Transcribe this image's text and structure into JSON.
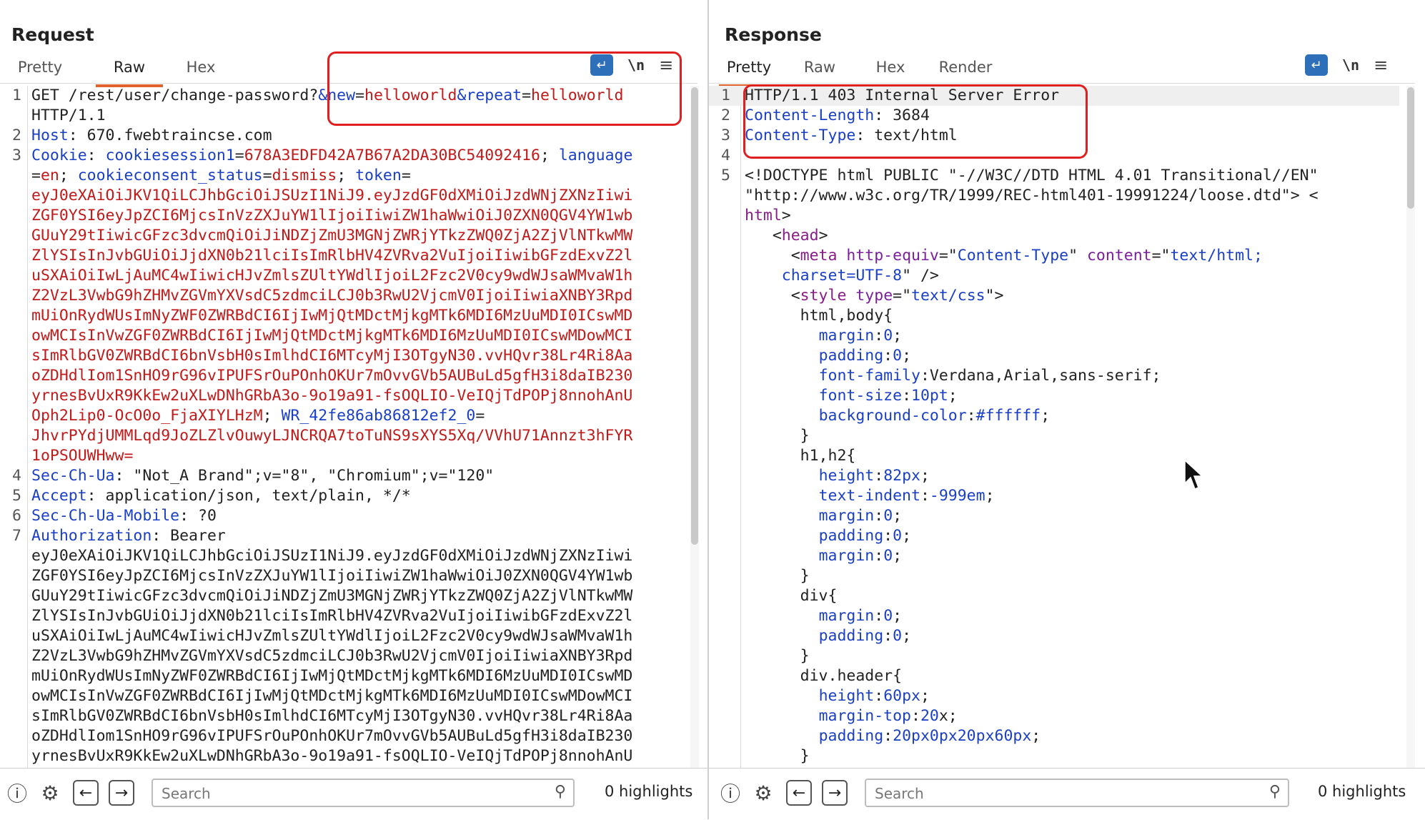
{
  "layout_switch": {
    "options": [
      "split-horizontal",
      "split-vertical",
      "single"
    ],
    "active": "split-horizontal"
  },
  "request": {
    "title": "Request",
    "tabs": [
      "Pretty",
      "Raw",
      "Hex"
    ],
    "active_tab": "Raw",
    "lines": [
      {
        "n": "1",
        "segs": [
          [
            "d",
            "GET /rest/user/change-password?"
          ],
          [
            "b",
            "&new"
          ],
          [
            "d",
            "="
          ],
          [
            "r",
            "helloworld"
          ],
          [
            "b",
            "&repeat"
          ],
          [
            "d",
            "="
          ],
          [
            "r",
            "helloworld"
          ]
        ]
      },
      {
        "n": "",
        "segs": [
          [
            "d",
            "HTTP/1.1"
          ]
        ]
      },
      {
        "n": "2",
        "segs": [
          [
            "b",
            "Host"
          ],
          [
            "d",
            ": 670.fwebtraincse.com"
          ]
        ]
      },
      {
        "n": "3",
        "segs": [
          [
            "b",
            "Cookie"
          ],
          [
            "d",
            ": "
          ],
          [
            "b",
            "cookiesession1"
          ],
          [
            "d",
            "="
          ],
          [
            "r",
            "678A3EDFD42A7B67A2DA30BC54092416"
          ],
          [
            "d",
            "; "
          ],
          [
            "b",
            "language"
          ]
        ]
      },
      {
        "n": "",
        "segs": [
          [
            "d",
            "="
          ],
          [
            "r",
            "en"
          ],
          [
            "d",
            "; "
          ],
          [
            "b",
            "cookieconsent_status"
          ],
          [
            "d",
            "="
          ],
          [
            "r",
            "dismiss"
          ],
          [
            "d",
            "; "
          ],
          [
            "b",
            "token"
          ],
          [
            "d",
            "="
          ]
        ]
      },
      {
        "n": "",
        "segs": [
          [
            "r",
            "eyJ0eXAiOiJKV1QiLCJhbGciOiJSUzI1NiJ9.eyJzdGF0dXMiOiJzdWNjZXNzIiwi"
          ]
        ]
      },
      {
        "n": "",
        "segs": [
          [
            "r",
            "ZGF0YSI6eyJpZCI6MjcsInVzZXJuYW1lIjoiIiwiZW1haWwiOiJ0ZXN0QGV4YW1wb"
          ]
        ]
      },
      {
        "n": "",
        "segs": [
          [
            "r",
            "GUuY29tIiwicGFzc3dvcmQiOiJiNDZjZmU3MGNjZWRjYTkzZWQ0ZjA2ZjVlNTkwMW"
          ]
        ]
      },
      {
        "n": "",
        "segs": [
          [
            "r",
            "ZlYSIsInJvbGUiOiJjdXN0b21lciIsImRlbHV4ZVRva2VuIjoiIiwibGFzdExvZ2l"
          ]
        ]
      },
      {
        "n": "",
        "segs": [
          [
            "r",
            "uSXAiOiIwLjAuMC4wIiwicHJvZmlsZUltYWdlIjoiL2Fzc2V0cy9wdWJsaWMvaW1h"
          ]
        ]
      },
      {
        "n": "",
        "segs": [
          [
            "r",
            "Z2VzL3VwbG9hZHMvZGVmYXVsdC5zdmciLCJ0b3RwU2VjcmV0IjoiIiwiaXNBY3Rpd"
          ]
        ]
      },
      {
        "n": "",
        "segs": [
          [
            "r",
            "mUiOnRydWUsImNyZWF0ZWRBdCI6IjIwMjQtMDctMjkgMTk6MDI6MzUuMDI0ICswMD"
          ]
        ]
      },
      {
        "n": "",
        "segs": [
          [
            "r",
            "owMCIsInVwZGF0ZWRBdCI6IjIwMjQtMDctMjkgMTk6MDI6MzUuMDI0ICswMDowMCI"
          ]
        ]
      },
      {
        "n": "",
        "segs": [
          [
            "r",
            "sImRlbGV0ZWRBdCI6bnVsbH0sImlhdCI6MTcyMjI3OTgyN30.vvHQvr38Lr4Ri8Aa"
          ]
        ]
      },
      {
        "n": "",
        "segs": [
          [
            "r",
            "oZDHdlIom1SnHO9rG96vIPUFSrOuPOnhOKUr7mOvvGVb5AUBuLd5gfH3i8daIB230"
          ]
        ]
      },
      {
        "n": "",
        "segs": [
          [
            "r",
            "yrnesBvUxR9KkEw2uXLwDNhGRbA3o-9o19a91-fsOQLIO-VeIQjTdPOPj8nnohAnU"
          ]
        ]
      },
      {
        "n": "",
        "segs": [
          [
            "r",
            "Oph2Lip0-OcO0o_FjaXIYLHzM"
          ],
          [
            "d",
            "; "
          ],
          [
            "b",
            "WR_42fe86ab86812ef2_0"
          ],
          [
            "d",
            "="
          ]
        ]
      },
      {
        "n": "",
        "segs": [
          [
            "r",
            "JhvrPYdjUMMLqd9JoZLZlvOuwyLJNCRQA7toTuNS9sXYS5Xq/VVhU71Annzt3hFYR"
          ]
        ]
      },
      {
        "n": "",
        "segs": [
          [
            "r",
            "1oPSOUWHww="
          ]
        ]
      },
      {
        "n": "4",
        "segs": [
          [
            "b",
            "Sec-Ch-Ua"
          ],
          [
            "d",
            ": \"Not_A Brand\";v=\"8\", \"Chromium\";v=\"120\""
          ]
        ]
      },
      {
        "n": "5",
        "segs": [
          [
            "b",
            "Accept"
          ],
          [
            "d",
            ": application/json, text/plain, */*"
          ]
        ]
      },
      {
        "n": "6",
        "segs": [
          [
            "b",
            "Sec-Ch-Ua-Mobile"
          ],
          [
            "d",
            ": ?0"
          ]
        ]
      },
      {
        "n": "7",
        "segs": [
          [
            "b",
            "Authorization"
          ],
          [
            "d",
            ": Bearer"
          ]
        ]
      },
      {
        "n": "",
        "segs": [
          [
            "d",
            "eyJ0eXAiOiJKV1QiLCJhbGciOiJSUzI1NiJ9.eyJzdGF0dXMiOiJzdWNjZXNzIiwi"
          ]
        ]
      },
      {
        "n": "",
        "segs": [
          [
            "d",
            "ZGF0YSI6eyJpZCI6MjcsInVzZXJuYW1lIjoiIiwiZW1haWwiOiJ0ZXN0QGV4YW1wb"
          ]
        ]
      },
      {
        "n": "",
        "segs": [
          [
            "d",
            "GUuY29tIiwicGFzc3dvcmQiOiJiNDZjZmU3MGNjZWRjYTkzZWQ0ZjA2ZjVlNTkwMW"
          ]
        ]
      },
      {
        "n": "",
        "segs": [
          [
            "d",
            "ZlYSIsInJvbGUiOiJjdXN0b21lciIsImRlbHV4ZVRva2VuIjoiIiwibGFzdExvZ2l"
          ]
        ]
      },
      {
        "n": "",
        "segs": [
          [
            "d",
            "uSXAiOiIwLjAuMC4wIiwicHJvZmlsZUltYWdlIjoiL2Fzc2V0cy9wdWJsaWMvaW1h"
          ]
        ]
      },
      {
        "n": "",
        "segs": [
          [
            "d",
            "Z2VzL3VwbG9hZHMvZGVmYXVsdC5zdmciLCJ0b3RwU2VjcmV0IjoiIiwiaXNBY3Rpd"
          ]
        ]
      },
      {
        "n": "",
        "segs": [
          [
            "d",
            "mUiOnRydWUsImNyZWF0ZWRBdCI6IjIwMjQtMDctMjkgMTk6MDI6MzUuMDI0ICswMD"
          ]
        ]
      },
      {
        "n": "",
        "segs": [
          [
            "d",
            "owMCIsInVwZGF0ZWRBdCI6IjIwMjQtMDctMjkgMTk6MDI6MzUuMDI0ICswMDowMCI"
          ]
        ]
      },
      {
        "n": "",
        "segs": [
          [
            "d",
            "sImRlbGV0ZWRBdCI6bnVsbH0sImlhdCI6MTcyMjI3OTgyN30.vvHQvr38Lr4Ri8Aa"
          ]
        ]
      },
      {
        "n": "",
        "segs": [
          [
            "d",
            "oZDHdlIom1SnHO9rG96vIPUFSrOuPOnhOKUr7mOvvGVb5AUBuLd5gfH3i8daIB230"
          ]
        ]
      },
      {
        "n": "",
        "segs": [
          [
            "d",
            "yrnesBvUxR9KkEw2uXLwDNhGRbA3o-9o19a91-fsOQLIO-VeIQjTdPOPj8nnohAnU"
          ]
        ]
      }
    ],
    "search_placeholder": "Search",
    "highlights": "0 highlights"
  },
  "response": {
    "title": "Response",
    "tabs": [
      "Pretty",
      "Raw",
      "Hex",
      "Render"
    ],
    "active_tab": "Pretty",
    "lines": [
      {
        "n": "1",
        "hl": true,
        "segs": [
          [
            "d",
            "HTTP/1.1 403 Internal Server Error"
          ]
        ]
      },
      {
        "n": "2",
        "segs": [
          [
            "b",
            "Content-Length"
          ],
          [
            "d",
            ": 3684"
          ]
        ]
      },
      {
        "n": "3",
        "segs": [
          [
            "b",
            "Content-Type"
          ],
          [
            "d",
            ": text/html"
          ]
        ]
      },
      {
        "n": "4",
        "segs": [
          [
            "d",
            ""
          ]
        ]
      },
      {
        "n": "5",
        "segs": [
          [
            "d",
            "<!DOCTYPE html PUBLIC \"-//W3C//DTD HTML 4.01 Transitional//EN\""
          ]
        ]
      },
      {
        "n": "",
        "segs": [
          [
            "d",
            "\"http://www.w3c.org/TR/1999/REC-html401-19991224/loose.dtd\"> <"
          ]
        ]
      },
      {
        "n": "",
        "segs": [
          [
            "t",
            "html"
          ],
          [
            "d",
            ">"
          ]
        ]
      },
      {
        "n": "",
        "segs": [
          [
            "d",
            "   <"
          ],
          [
            "t",
            "head"
          ],
          [
            "d",
            ">"
          ]
        ]
      },
      {
        "n": "",
        "segs": [
          [
            "d",
            "     <"
          ],
          [
            "t",
            "meta"
          ],
          [
            "d",
            " "
          ],
          [
            "a",
            "http-equiv"
          ],
          [
            "d",
            "=\""
          ],
          [
            "v",
            "Content-Type"
          ],
          [
            "d",
            "\" "
          ],
          [
            "a",
            "content"
          ],
          [
            "d",
            "=\""
          ],
          [
            "v",
            "text/html;"
          ]
        ]
      },
      {
        "n": "",
        "segs": [
          [
            "d",
            "    "
          ],
          [
            "v",
            "charset=UTF-8"
          ],
          [
            "d",
            "\" />"
          ]
        ]
      },
      {
        "n": "",
        "segs": [
          [
            "d",
            "     <"
          ],
          [
            "t",
            "style"
          ],
          [
            "d",
            " "
          ],
          [
            "a",
            "type"
          ],
          [
            "d",
            "=\""
          ],
          [
            "v",
            "text/css"
          ],
          [
            "d",
            "\">"
          ]
        ]
      },
      {
        "n": "",
        "segs": [
          [
            "d",
            "      html,body{"
          ]
        ]
      },
      {
        "n": "",
        "segs": [
          [
            "d",
            "        "
          ],
          [
            "b",
            "margin"
          ],
          [
            "d",
            ":"
          ],
          [
            "b",
            "0"
          ],
          [
            "d",
            ";"
          ]
        ]
      },
      {
        "n": "",
        "segs": [
          [
            "d",
            "        "
          ],
          [
            "b",
            "padding"
          ],
          [
            "d",
            ":"
          ],
          [
            "b",
            "0"
          ],
          [
            "d",
            ";"
          ]
        ]
      },
      {
        "n": "",
        "segs": [
          [
            "d",
            "        "
          ],
          [
            "b",
            "font-family"
          ],
          [
            "d",
            ":Verdana,Arial,sans-serif;"
          ]
        ]
      },
      {
        "n": "",
        "segs": [
          [
            "d",
            "        "
          ],
          [
            "b",
            "font-size"
          ],
          [
            "d",
            ":"
          ],
          [
            "b",
            "10pt"
          ],
          [
            "d",
            ";"
          ]
        ]
      },
      {
        "n": "",
        "segs": [
          [
            "d",
            "        "
          ],
          [
            "b",
            "background-color"
          ],
          [
            "d",
            ":"
          ],
          [
            "b",
            "#ffffff"
          ],
          [
            "d",
            ";"
          ]
        ]
      },
      {
        "n": "",
        "segs": [
          [
            "d",
            "      }"
          ]
        ]
      },
      {
        "n": "",
        "segs": [
          [
            "d",
            "      h1,h2{"
          ]
        ]
      },
      {
        "n": "",
        "segs": [
          [
            "d",
            "        "
          ],
          [
            "b",
            "height"
          ],
          [
            "d",
            ":"
          ],
          [
            "b",
            "82px"
          ],
          [
            "d",
            ";"
          ]
        ]
      },
      {
        "n": "",
        "segs": [
          [
            "d",
            "        "
          ],
          [
            "b",
            "text-indent"
          ],
          [
            "d",
            ":"
          ],
          [
            "b",
            "-999em"
          ],
          [
            "d",
            ";"
          ]
        ]
      },
      {
        "n": "",
        "segs": [
          [
            "d",
            "        "
          ],
          [
            "b",
            "margin"
          ],
          [
            "d",
            ":"
          ],
          [
            "b",
            "0"
          ],
          [
            "d",
            ";"
          ]
        ]
      },
      {
        "n": "",
        "segs": [
          [
            "d",
            "        "
          ],
          [
            "b",
            "padding"
          ],
          [
            "d",
            ":"
          ],
          [
            "b",
            "0"
          ],
          [
            "d",
            ";"
          ]
        ]
      },
      {
        "n": "",
        "segs": [
          [
            "d",
            "        "
          ],
          [
            "b",
            "margin"
          ],
          [
            "d",
            ":"
          ],
          [
            "b",
            "0"
          ],
          [
            "d",
            ";"
          ]
        ]
      },
      {
        "n": "",
        "segs": [
          [
            "d",
            "      }"
          ]
        ]
      },
      {
        "n": "",
        "segs": [
          [
            "d",
            "      div{"
          ]
        ]
      },
      {
        "n": "",
        "segs": [
          [
            "d",
            "        "
          ],
          [
            "b",
            "margin"
          ],
          [
            "d",
            ":"
          ],
          [
            "b",
            "0"
          ],
          [
            "d",
            ";"
          ]
        ]
      },
      {
        "n": "",
        "segs": [
          [
            "d",
            "        "
          ],
          [
            "b",
            "padding"
          ],
          [
            "d",
            ":"
          ],
          [
            "b",
            "0"
          ],
          [
            "d",
            ";"
          ]
        ]
      },
      {
        "n": "",
        "segs": [
          [
            "d",
            "      }"
          ]
        ]
      },
      {
        "n": "",
        "segs": [
          [
            "d",
            "      div.header{"
          ]
        ]
      },
      {
        "n": "",
        "segs": [
          [
            "d",
            "        "
          ],
          [
            "b",
            "height"
          ],
          [
            "d",
            ":"
          ],
          [
            "b",
            "60px"
          ],
          [
            "d",
            ";"
          ]
        ]
      },
      {
        "n": "",
        "segs": [
          [
            "d",
            "        "
          ],
          [
            "b",
            "margin-top"
          ],
          [
            "d",
            ":"
          ],
          [
            "b",
            "20"
          ],
          [
            "d",
            "x;"
          ]
        ]
      },
      {
        "n": "",
        "segs": [
          [
            "d",
            "        "
          ],
          [
            "b",
            "padding"
          ],
          [
            "d",
            ":"
          ],
          [
            "b",
            "20px0px20px60px"
          ],
          [
            "d",
            ";"
          ]
        ]
      },
      {
        "n": "",
        "segs": [
          [
            "d",
            "      }"
          ]
        ]
      }
    ],
    "search_placeholder": "Search",
    "highlights": "0 highlights"
  }
}
